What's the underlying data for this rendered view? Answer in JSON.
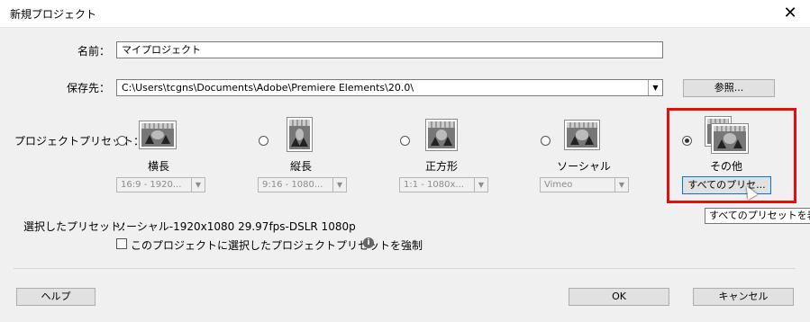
{
  "window": {
    "title": "新規プロジェクト",
    "close_icon": "close-icon"
  },
  "name_field": {
    "label": "名前：",
    "value": "マイプロジェクト"
  },
  "save_location": {
    "label": "保存先：",
    "value": "C:\\Users\\tcgns\\Documents\\Adobe\\Premiere Elements\\20.0\\",
    "browse_button": "参照..."
  },
  "presets": {
    "label": "プロジェクトプリセット：",
    "items": [
      {
        "label": "横長",
        "selected": false,
        "dropdown": "16:9 - 1920..."
      },
      {
        "label": "縦長",
        "selected": false,
        "dropdown": "9:16 - 1080..."
      },
      {
        "label": "正方形",
        "selected": false,
        "dropdown": "1:1 - 1080x..."
      },
      {
        "label": "ソーシャル",
        "selected": false,
        "dropdown": "Vimeo"
      },
      {
        "label": "その他",
        "selected": true,
        "button": "すべてのプリセ..."
      }
    ]
  },
  "tooltip": "すべてのプリセットを表示",
  "selected_preset": {
    "label": "選択したプリセット：",
    "value": "ソーシャル-1920x1080 29.97fps-DSLR 1080p"
  },
  "force_checkbox": {
    "label": "このプロジェクトに選択したプロジェクトプリセットを強制",
    "checked": false
  },
  "footer": {
    "help": "ヘルプ",
    "ok": "OK",
    "cancel": "キャンセル"
  }
}
